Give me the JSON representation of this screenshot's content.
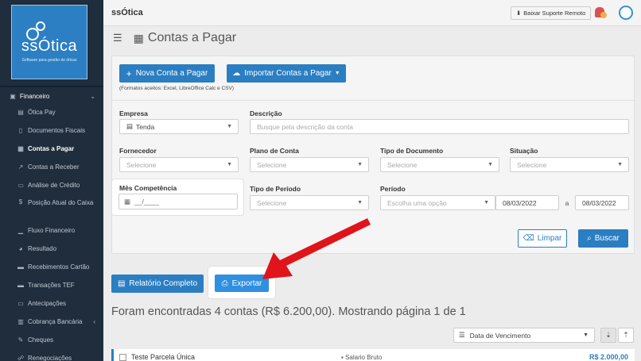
{
  "brand": {
    "logo_text": "ssÓtica",
    "logo_tagline": "Software para gestão de óticas",
    "topbar_logo": "ssÓtica"
  },
  "topbar": {
    "support_button": "Baixar Suporte Remoto"
  },
  "sidebar": {
    "section": "Financeiro",
    "items": [
      {
        "label": "Ótica Pay",
        "icon": "building-icon"
      },
      {
        "label": "Documentos Fiscais",
        "icon": "document-icon"
      },
      {
        "label": "Contas a Pagar",
        "icon": "table-icon"
      },
      {
        "label": "Contas a Receber",
        "icon": "chart-line-icon"
      },
      {
        "label": "Análise de Crédito",
        "icon": "id-card-icon"
      },
      {
        "label": "Posição Atual do Caixa",
        "icon": "dollar-icon"
      },
      {
        "label": "Fluxo Financeiro",
        "icon": "bar-chart-icon"
      },
      {
        "label": "Resultado",
        "icon": "pie-chart-icon"
      },
      {
        "label": "Recebimentos Cartão",
        "icon": "card-icon"
      },
      {
        "label": "Transações TEF",
        "icon": "card-stack-icon"
      },
      {
        "label": "Antecipações",
        "icon": "card-forward-icon"
      },
      {
        "label": "Cobrança Bancária",
        "icon": "bank-icon"
      },
      {
        "label": "Cheques",
        "icon": "check-icon"
      },
      {
        "label": "Renegociações",
        "icon": "handshake-icon"
      }
    ]
  },
  "page": {
    "title": "Contas a Pagar"
  },
  "actions": {
    "new_bill": "Nova Conta a Pagar",
    "import": "Importar Contas a Pagar",
    "formats_note": "(Formatos aceitos: Excel, LibreOffice Calc e CSV)"
  },
  "filters": {
    "empresa_label": "Empresa",
    "empresa_value": "Tenda",
    "descricao_label": "Descrição",
    "descricao_placeholder": "Busque pela descrição da conta",
    "fornecedor_label": "Fornecedor",
    "fornecedor_value": "Selecione",
    "plano_label": "Plano de Conta",
    "plano_value": "Selecione",
    "tipo_doc_label": "Tipo de Documento",
    "tipo_doc_value": "Selecione",
    "situacao_label": "Situação",
    "situacao_value": "Selecione",
    "mes_label": "Mês Competência",
    "mes_value": "__/____",
    "tipo_periodo_label": "Tipo de Período",
    "tipo_periodo_value": "Selecione",
    "periodo_label": "Período",
    "periodo_value": "Escolha uma opção",
    "date_from": "08/03/2022",
    "date_sep": "a",
    "date_to": "08/03/2022",
    "clear_button": "Limpar",
    "search_button": "Buscar"
  },
  "report": {
    "full_report": "Relatório Completo",
    "export": "Exportar"
  },
  "results": {
    "summary": "Foram encontradas 4 contas (R$ 6.200,00). Mostrando página 1 de 1",
    "sort_value": "Data de Vencimento"
  },
  "rows": [
    {
      "name": "Teste Parcela Única",
      "category": "Salario Bruto",
      "value": "R$ 2.000,00"
    }
  ],
  "colors": {
    "sidebar_bg": "#1f2d3d",
    "primary": "#2b7ec1",
    "arrow": "#e0141a"
  }
}
